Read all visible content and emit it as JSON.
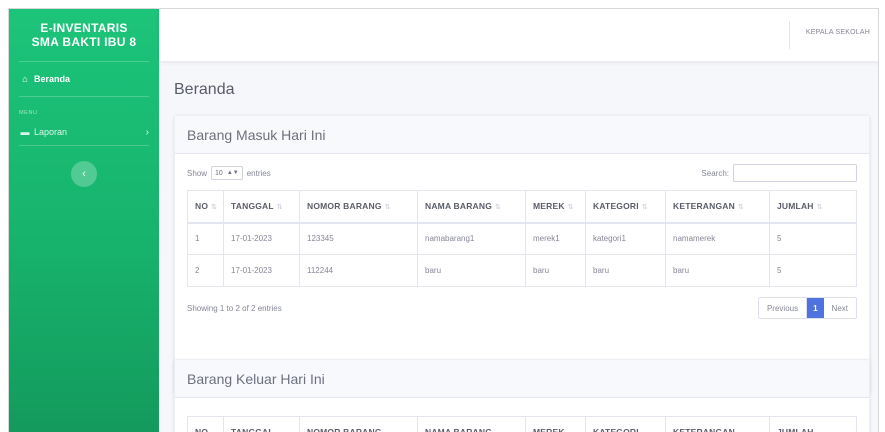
{
  "brand": {
    "line1": "E-INVENTARIS",
    "line2": "SMA BAKTI IBU 8"
  },
  "sidebar": {
    "home": {
      "icon": "home-icon",
      "label": "Beranda"
    },
    "menu_heading": "MENU",
    "items": [
      {
        "icon": "folder-icon",
        "label": "Laporan"
      }
    ],
    "toggle_icon": "chevron-left-icon"
  },
  "topbar": {
    "user": "KEPALA SEKOLAH"
  },
  "page": {
    "title": "Beranda"
  },
  "masuk": {
    "title": "Barang Masuk Hari Ini",
    "show_prefix": "Show",
    "entries_value": "10",
    "show_suffix": "entries",
    "search_label": "Search:",
    "search_value": "",
    "columns": [
      "NO",
      "TANGGAL",
      "NOMOR BARANG",
      "NAMA BARANG",
      "MEREK",
      "KATEGORI",
      "KETERANGAN",
      "JUMLAH"
    ],
    "rows": [
      [
        "1",
        "17-01-2023",
        "123345",
        "namabarang1",
        "merek1",
        "kategori1",
        "namamerek",
        "5"
      ],
      [
        "2",
        "17-01-2023",
        "112244",
        "baru",
        "baru",
        "baru",
        "baru",
        "5"
      ]
    ],
    "info": "Showing 1 to 2 of 2 entries",
    "pagination": {
      "previous": "Previous",
      "current": "1",
      "next": "Next"
    }
  },
  "keluar": {
    "title": "Barang Keluar Hari Ini",
    "columns": [
      "NO",
      "TANGGAL",
      "NOMOR BARANG",
      "NAMA BARANG",
      "MEREK",
      "KATEGORI",
      "KETERANGAN",
      "JUMLAH"
    ]
  },
  "colors": {
    "sidebar": "#1cc47a",
    "accent": "#4e73df"
  }
}
